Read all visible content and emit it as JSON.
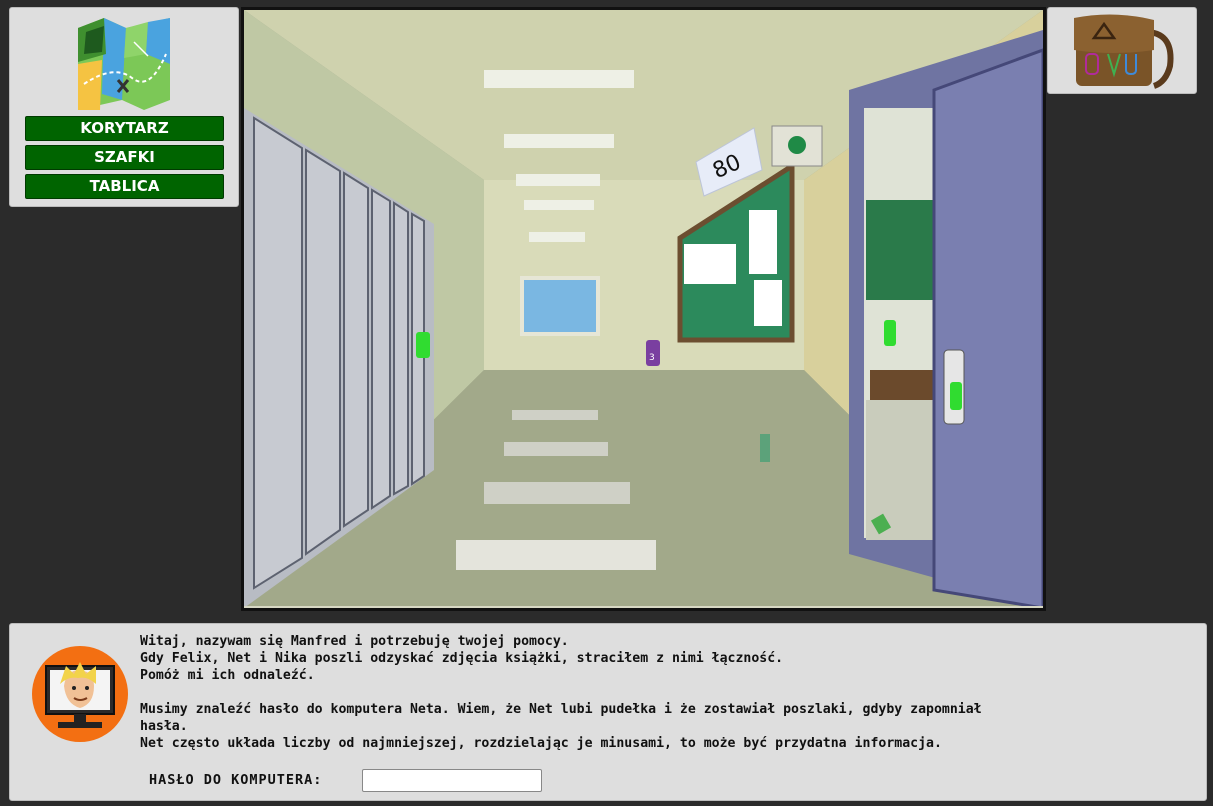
{
  "nav": {
    "map_icon": "map-icon",
    "buttons": [
      "KORYTARZ",
      "SZAFKI",
      "TABLICA"
    ]
  },
  "inventory": {
    "icon": "bag-icon"
  },
  "scene": {
    "room_number": "80",
    "door_tag_number": "3"
  },
  "dialog": {
    "avatar_icon": "manfred-monitor-avatar",
    "lines": [
      "Witaj, nazywam się Manfred i potrzebuję twojej pomocy.",
      "Gdy Felix, Net i Nika poszli odzyskać zdjęcia książki, straciłem z nimi łączność.",
      "Pomóż mi ich odnaleźć.",
      "Musimy znaleźć hasło do komputera Neta. Wiem, że Net lubi pudełka i że zostawiał poszlaki, gdyby zapomniał",
      "hasła.",
      "Net często układa liczby od najmniejszej, rozdzielając je minusami, to może być przydatna informacja."
    ],
    "password_label": "HASŁO DO KOMPUTERA:",
    "password_value": ""
  },
  "colors": {
    "nav_button": "#006400",
    "avatar_bg": "#f36f12",
    "panel_bg": "#dedede",
    "page_bg": "#2b2b2b"
  }
}
